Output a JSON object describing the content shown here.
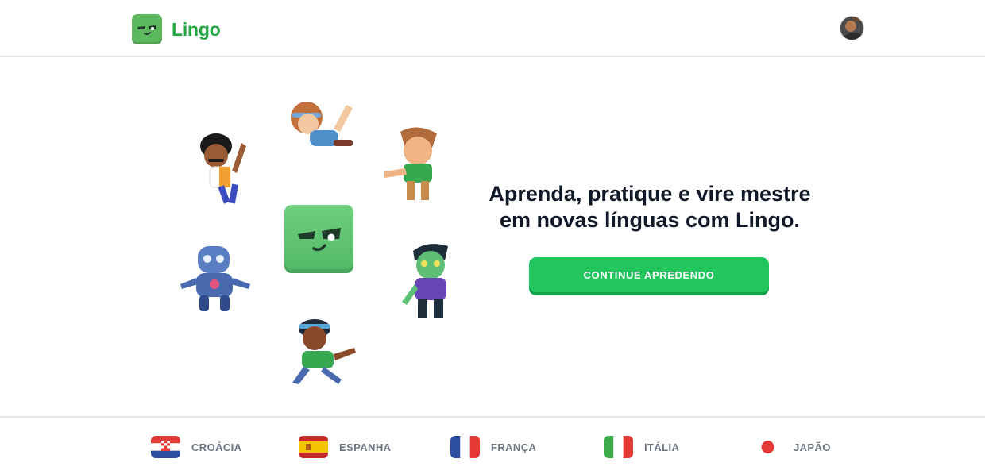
{
  "header": {
    "brand_name": "Lingo",
    "logo_icon": "lingo-mascot-icon",
    "avatar_icon": "user-avatar"
  },
  "hero": {
    "headline_line1": "Aprenda, pratique e vire mestre",
    "headline_line2": "em novas línguas com Lingo.",
    "cta_label": "CONTINUE APREDENDO"
  },
  "footer": {
    "countries": [
      {
        "label": "CROÁCIA",
        "flag": "croatia-flag-icon"
      },
      {
        "label": "ESPANHA",
        "flag": "spain-flag-icon"
      },
      {
        "label": "FRANÇA",
        "flag": "france-flag-icon"
      },
      {
        "label": "ITÁLIA",
        "flag": "italy-flag-icon"
      },
      {
        "label": "JAPÃO",
        "flag": "japan-flag-icon"
      }
    ]
  },
  "colors": {
    "brand_green": "#22a843",
    "cta_green": "#22c55e",
    "cta_shadow": "#15a34a",
    "mascot_green": "#5cb85c",
    "border": "#e5e7eb",
    "footer_text": "#6b7280"
  }
}
